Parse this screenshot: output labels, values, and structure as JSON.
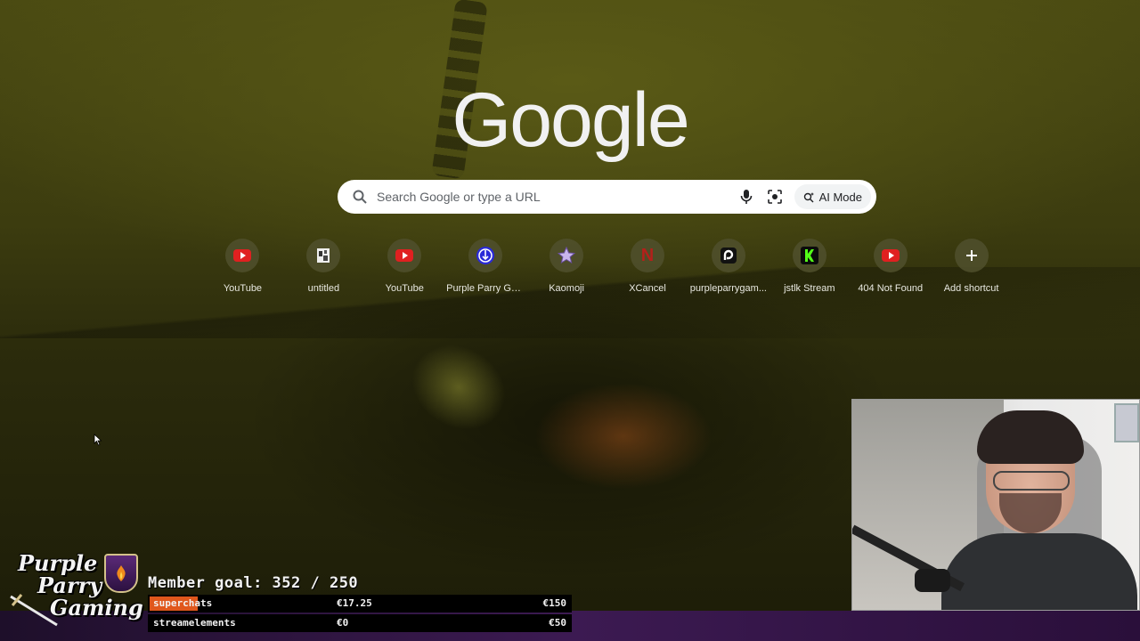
{
  "google": {
    "logo_text": "Google",
    "search_placeholder": "Search Google or type a URL",
    "ai_mode_label": "AI Mode"
  },
  "shortcuts": [
    {
      "label": "YouTube",
      "icon": "youtube-icon"
    },
    {
      "label": "untitled",
      "icon": "document-icon"
    },
    {
      "label": "YouTube",
      "icon": "youtube-icon"
    },
    {
      "label": "Purple Parry Ga...",
      "icon": "purple-parry-icon"
    },
    {
      "label": "Kaomoji",
      "icon": "star-icon"
    },
    {
      "label": "XCancel",
      "icon": "netflix-n-icon"
    },
    {
      "label": "purpleparrygam...",
      "icon": "patreon-icon"
    },
    {
      "label": "jstlk Stream",
      "icon": "kick-icon"
    },
    {
      "label": "404 Not Found",
      "icon": "youtube-icon"
    },
    {
      "label": "Add shortcut",
      "icon": "plus-icon"
    }
  ],
  "overlay": {
    "brand_lines": [
      "Purple",
      "Parry",
      "Gaming"
    ],
    "member_goal": "Member goal: 352 / 250",
    "goals": [
      {
        "name": "superchats",
        "current": "€17.25",
        "target": "€150",
        "progress": 0.115
      },
      {
        "name": "streamelements",
        "current": "€0",
        "target": "€50",
        "progress": 0
      }
    ]
  },
  "colors": {
    "youtube_red": "#e02020",
    "kick_green": "#53fc18",
    "goal_bar_fill": "#e0571c",
    "overlay_purple": "#3c1a52"
  }
}
